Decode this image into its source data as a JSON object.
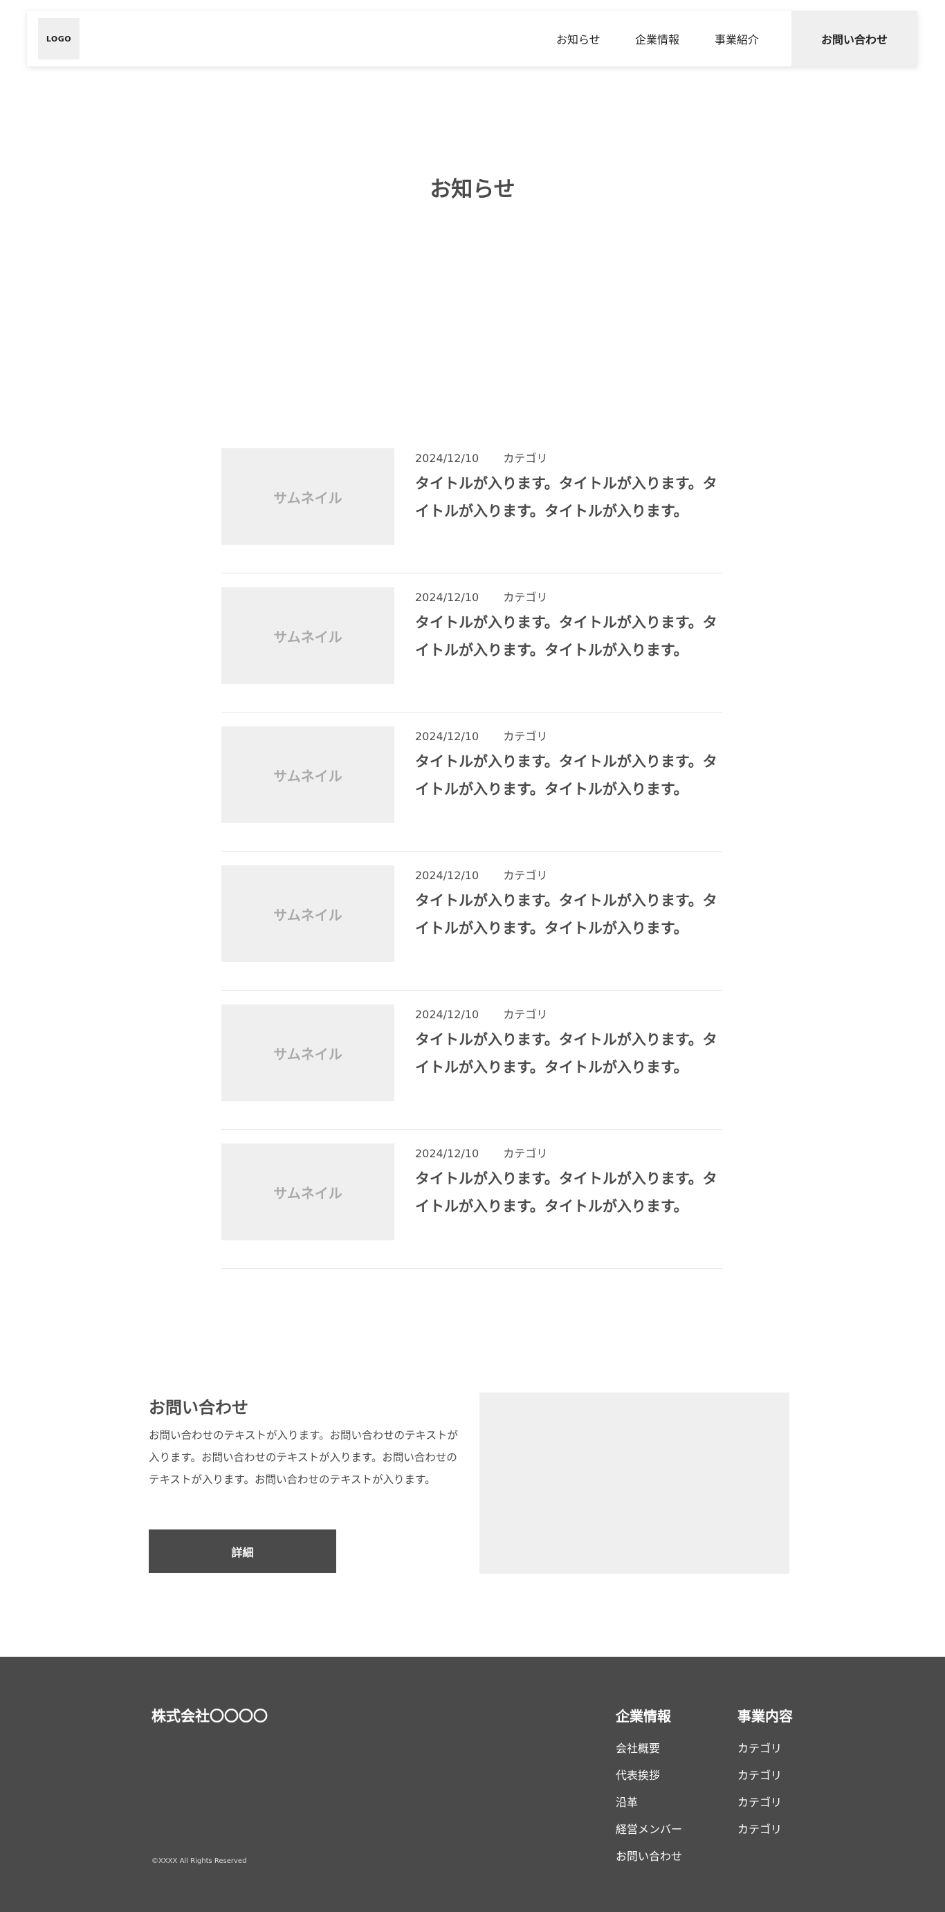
{
  "header": {
    "logo": "LOGO",
    "nav": [
      "お知らせ",
      "企業情報",
      "事業紹介"
    ],
    "contact_button": "お問い合わせ"
  },
  "page_title": "お知らせ",
  "news": [
    {
      "date": "2024/12/10",
      "category": "カテゴリ",
      "thumbnail": "サムネイル",
      "title": "タイトルが入ります。タイトルが入ります。タイトルが入ります。タイトルが入ります。"
    },
    {
      "date": "2024/12/10",
      "category": "カテゴリ",
      "thumbnail": "サムネイル",
      "title": "タイトルが入ります。タイトルが入ります。タイトルが入ります。タイトルが入ります。"
    },
    {
      "date": "2024/12/10",
      "category": "カテゴリ",
      "thumbnail": "サムネイル",
      "title": "タイトルが入ります。タイトルが入ります。タイトルが入ります。タイトルが入ります。"
    },
    {
      "date": "2024/12/10",
      "category": "カテゴリ",
      "thumbnail": "サムネイル",
      "title": "タイトルが入ります。タイトルが入ります。タイトルが入ります。タイトルが入ります。"
    },
    {
      "date": "2024/12/10",
      "category": "カテゴリ",
      "thumbnail": "サムネイル",
      "title": "タイトルが入ります。タイトルが入ります。タイトルが入ります。タイトルが入ります。"
    },
    {
      "date": "2024/12/10",
      "category": "カテゴリ",
      "thumbnail": "サムネイル",
      "title": "タイトルが入ります。タイトルが入ります。タイトルが入ります。タイトルが入ります。"
    }
  ],
  "contact": {
    "heading": "お問い合わせ",
    "text": "お問い合わせのテキストが入ります。お問い合わせのテキストが入ります。お問い合わせのテキストが入ります。お問い合わせのテキストが入ります。お問い合わせのテキストが入ります。",
    "button": "詳細"
  },
  "footer": {
    "company": "株式会社〇〇〇〇",
    "copyright": "©XXXX All Rights Reserved",
    "col1": {
      "title": "企業情報",
      "items": [
        "会社概要",
        "代表挨拶",
        "沿革",
        "経営メンバー",
        "お問い合わせ"
      ]
    },
    "col2": {
      "title": "事業内容",
      "items": [
        "カテゴリ",
        "カテゴリ",
        "カテゴリ",
        "カテゴリ"
      ]
    }
  },
  "colors": {
    "dark": "#4a4a4a",
    "light_gray": "#efefef",
    "thumb_text": "#a9a9a9"
  }
}
